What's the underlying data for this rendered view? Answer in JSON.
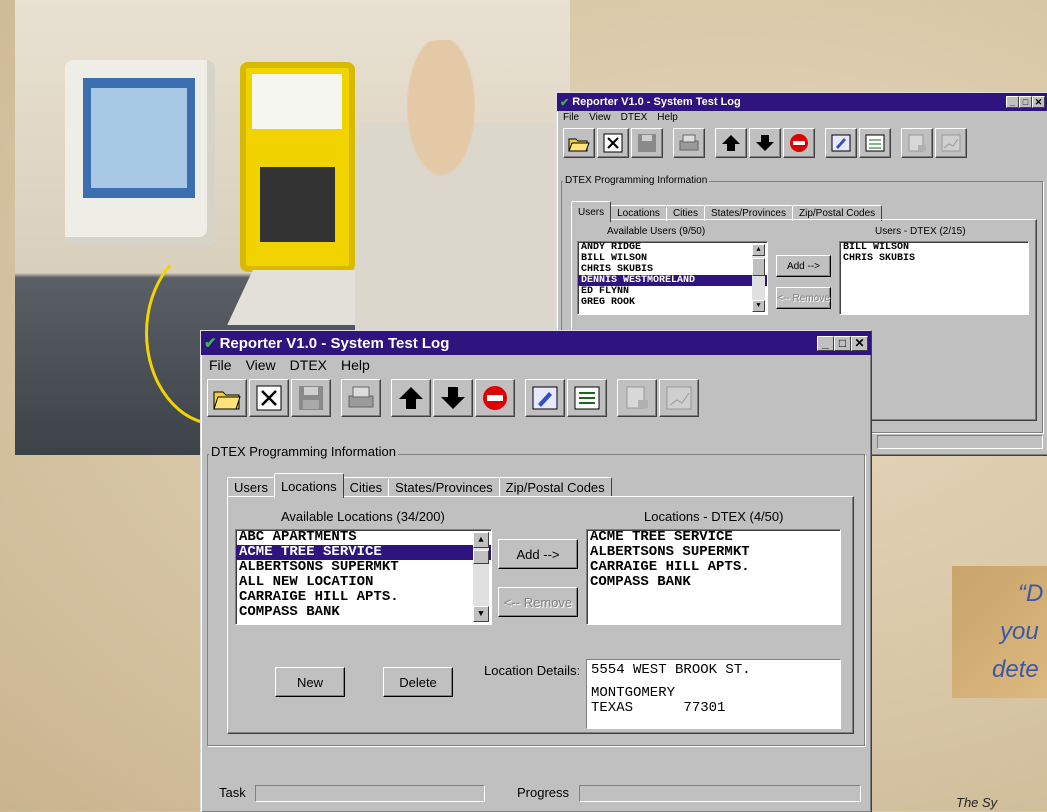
{
  "back_window": {
    "title": "Reporter V1.0 - System Test Log",
    "menu": [
      "File",
      "View",
      "DTEX",
      "Help"
    ],
    "group_label": "DTEX Programming Information",
    "tabs": [
      "Users",
      "Locations",
      "Cities",
      "States/Provinces",
      "Zip/Postal Codes"
    ],
    "active_tab": "Users",
    "available_label": "Available Users (9/50)",
    "available_items": [
      "ANDY RIDGE",
      "BILL WILSON",
      "CHRIS SKUBIS",
      "DENNIS WESTMORELAND",
      "ED FLYNN",
      "GREG ROOK"
    ],
    "selected_item": "DENNIS WESTMORELAND",
    "dtex_label": "Users - DTEX (2/15)",
    "dtex_items": [
      "BILL WILSON",
      "CHRIS SKUBIS"
    ],
    "add_label": "Add -->",
    "remove_label": "<-- Remove"
  },
  "front_window": {
    "title": "Reporter V1.0 - System Test Log",
    "menu": [
      "File",
      "View",
      "DTEX",
      "Help"
    ],
    "group_label": "DTEX Programming Information",
    "tabs": [
      "Users",
      "Locations",
      "Cities",
      "States/Provinces",
      "Zip/Postal Codes"
    ],
    "active_tab": "Locations",
    "available_label": "Available Locations (34/200)",
    "available_items": [
      "ABC APARTMENTS",
      "ACME TREE SERVICE",
      "ALBERTSONS SUPERMKT",
      "ALL NEW LOCATION",
      "CARRAIGE HILL APTS.",
      "COMPASS BANK"
    ],
    "selected_item": "ACME TREE SERVICE",
    "dtex_label": "Locations - DTEX (4/50)",
    "dtex_items": [
      "ACME TREE SERVICE",
      "ALBERTSONS SUPERMKT",
      "CARRAIGE HILL APTS.",
      "COMPASS BANK"
    ],
    "add_label": "Add -->",
    "remove_label": "<-- Remove",
    "new_label": "New",
    "delete_label": "Delete",
    "details_label": "Location Details:",
    "details_line1": "5554 WEST BROOK ST.",
    "details_line2": "MONTGOMERY",
    "details_line3": "TEXAS      77301",
    "task_label": "Task",
    "progress_label": "Progress"
  },
  "toolbar_icons": [
    "open-folder-icon",
    "close-x-icon",
    "save-disk-icon",
    "print-icon",
    "upload-arrow-icon",
    "download-arrow-icon",
    "stop-icon",
    "notes-icon",
    "checklist-icon",
    "report-icon",
    "graph-icon"
  ],
  "quote_lines": [
    "“D",
    "you",
    "dete"
  ],
  "caption": "The Sy",
  "colors": {
    "titlebar": "#2f137e",
    "window": "#c0c0c0",
    "quote_text": "#3a58a8"
  }
}
